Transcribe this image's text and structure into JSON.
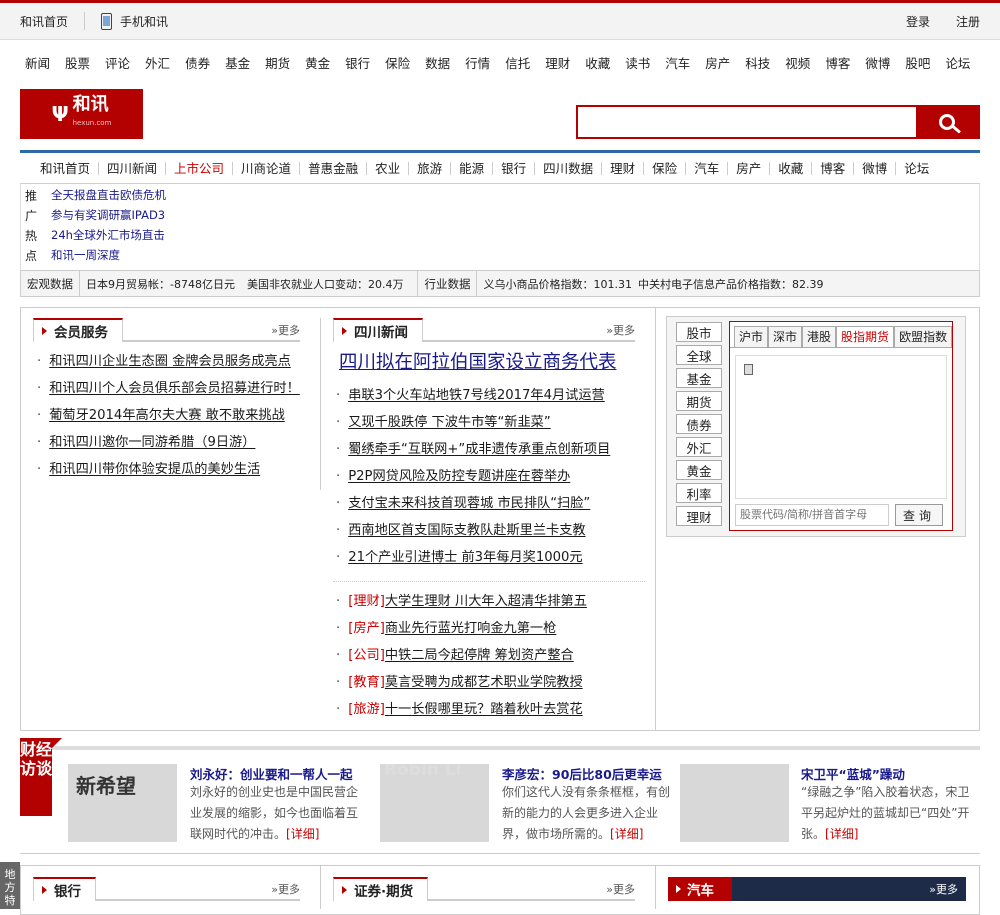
{
  "topbar": {
    "home": "和讯首页",
    "mobile": "手机和讯",
    "login": "登录",
    "register": "注册"
  },
  "mainnav": [
    "新闻",
    "股票",
    "评论",
    "外汇",
    "债券",
    "基金",
    "期货",
    "黄金",
    "银行",
    "保险",
    "数据",
    "行情",
    "信托",
    "理财",
    "收藏",
    "读书",
    "汽车",
    "房产",
    "科技",
    "视频",
    "博客",
    "微博",
    "股吧",
    "论坛"
  ],
  "brand": {
    "mark": "Ψ",
    "name": "和讯",
    "sub": "hexun.com"
  },
  "search": {
    "placeholder": ""
  },
  "subnav": [
    "和讯首页",
    "四川新闻",
    "上市公司",
    "川商论道",
    "普惠金融",
    "农业",
    "旅游",
    "能源",
    "银行",
    "四川数据",
    "理财",
    "保险",
    "汽车",
    "房产",
    "收藏",
    "博客",
    "微博",
    "论坛"
  ],
  "promo": {
    "label": [
      "推",
      "广",
      "热",
      "点"
    ],
    "items": [
      "全天报盘直击欧债危机",
      "参与有奖调研赢IPAD3",
      "24h全球外汇市场直击",
      "和讯一周深度"
    ]
  },
  "databar": {
    "macro_label": "宏观数据",
    "macro": [
      "日本9月贸易帐：-8748亿日元",
      "美国非农就业人口变动：20.4万"
    ],
    "industry_label": "行业数据",
    "industry": [
      "义乌小商品价格指数：101.31",
      "中关村电子信息产品价格指数：82.39"
    ]
  },
  "member": {
    "title": "会员服务",
    "more": "»更多",
    "items": [
      "和讯四川企业生态圈 金牌会员服务成亮点",
      "和讯四川个人会员俱乐部会员招募进行时！",
      "葡萄牙2014年高尔夫大赛 敢不敢来挑战",
      "和讯四川邀你一同游希腊（9日游）",
      "和讯四川带你体验安提瓜的美妙生活"
    ]
  },
  "news": {
    "title": "四川新闻",
    "more": "»更多",
    "headline": "四川拟在阿拉伯国家设立商务代表",
    "items": [
      "串联3个火车站地铁7号线2017年4月试运营",
      "又现千股跌停 下波牛市等“新韭菜”",
      "蜀绣牵手“互联网+”成非遗传承重点创新项目",
      "P2P网贷风险及防控专题讲座在蓉举办",
      "支付宝未来科技首现蓉城 市民排队“扫脸”",
      "西南地区首支国际支教队赴斯里兰卡支教",
      "21个产业引进博士 前3年每月奖1000元"
    ],
    "tagged": [
      {
        "cat": "[理财]",
        "text": "大学生理财 川大年入超清华排第五"
      },
      {
        "cat": "[房产]",
        "text": "商业先行蓝光打响金九第一枪"
      },
      {
        "cat": "[公司]",
        "text": "中铁二局今起停牌 筹划资产整合"
      },
      {
        "cat": "[教育]",
        "text": "莫言受聘为成都艺术职业学院教授"
      },
      {
        "cat": "[旅游]",
        "text": "十一长假哪里玩？踏着秋叶去赏花"
      }
    ]
  },
  "market": {
    "buttons": [
      "股市",
      "全球",
      "基金",
      "期货",
      "债券",
      "外汇",
      "黄金",
      "利率",
      "理财"
    ],
    "tabs": [
      "沪市",
      "深市",
      "港股",
      "股指期货",
      "欧盟指数"
    ],
    "active_tab": 3,
    "query_placeholder": "股票代码/简称/拼音首字母",
    "query_button": "查询"
  },
  "interview": {
    "label": "财经访谈",
    "cards": [
      {
        "title": "刘永好：创业要和一帮人一起",
        "text": "刘永好的创业史也是中国民营企业发展的缩影，如今也面临着互联网时代的冲击。",
        "detail": "[详细]",
        "photo_text": "新希望"
      },
      {
        "title": "李彦宏：90后比80后更幸运",
        "text": "你们这代人没有条条框框，有创新的能力的人会更多进入企业界，做市场所需的。",
        "detail": "[详细]",
        "photo_text": "Robin Li"
      },
      {
        "title": "宋卫平“蓝城”躁动",
        "text": "“绿融之争”陷入胶着状态，宋卫平另起炉灶的蓝城却已“四处”开张。",
        "detail": "[详细]",
        "photo_text": ""
      }
    ]
  },
  "bottom": {
    "side": "地方特",
    "bank": "银行",
    "securities": "证券·期货",
    "auto": "汽车",
    "more": "»更多"
  },
  "colors": {
    "accent": "#b30000",
    "nav_blue": "#2e6aa8",
    "link": "#1a1a8c"
  }
}
